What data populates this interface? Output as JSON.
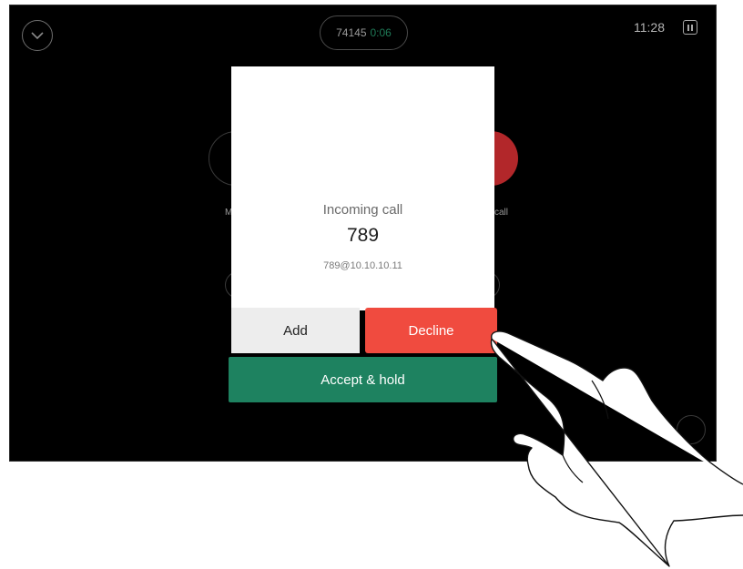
{
  "status_bar": {
    "call_number": "74145",
    "call_timer": "0:06",
    "clock": "11:28"
  },
  "background": {
    "left_label": "M",
    "right_label": "call"
  },
  "dialog": {
    "title": "Incoming call",
    "caller_number": "789",
    "caller_uri": "789@10.10.10.11"
  },
  "buttons": {
    "add": "Add",
    "decline": "Decline",
    "accept_hold": "Accept & hold"
  },
  "colors": {
    "decline": "#f04b3f",
    "accept": "#1e8260",
    "end_call": "#b2272a"
  }
}
